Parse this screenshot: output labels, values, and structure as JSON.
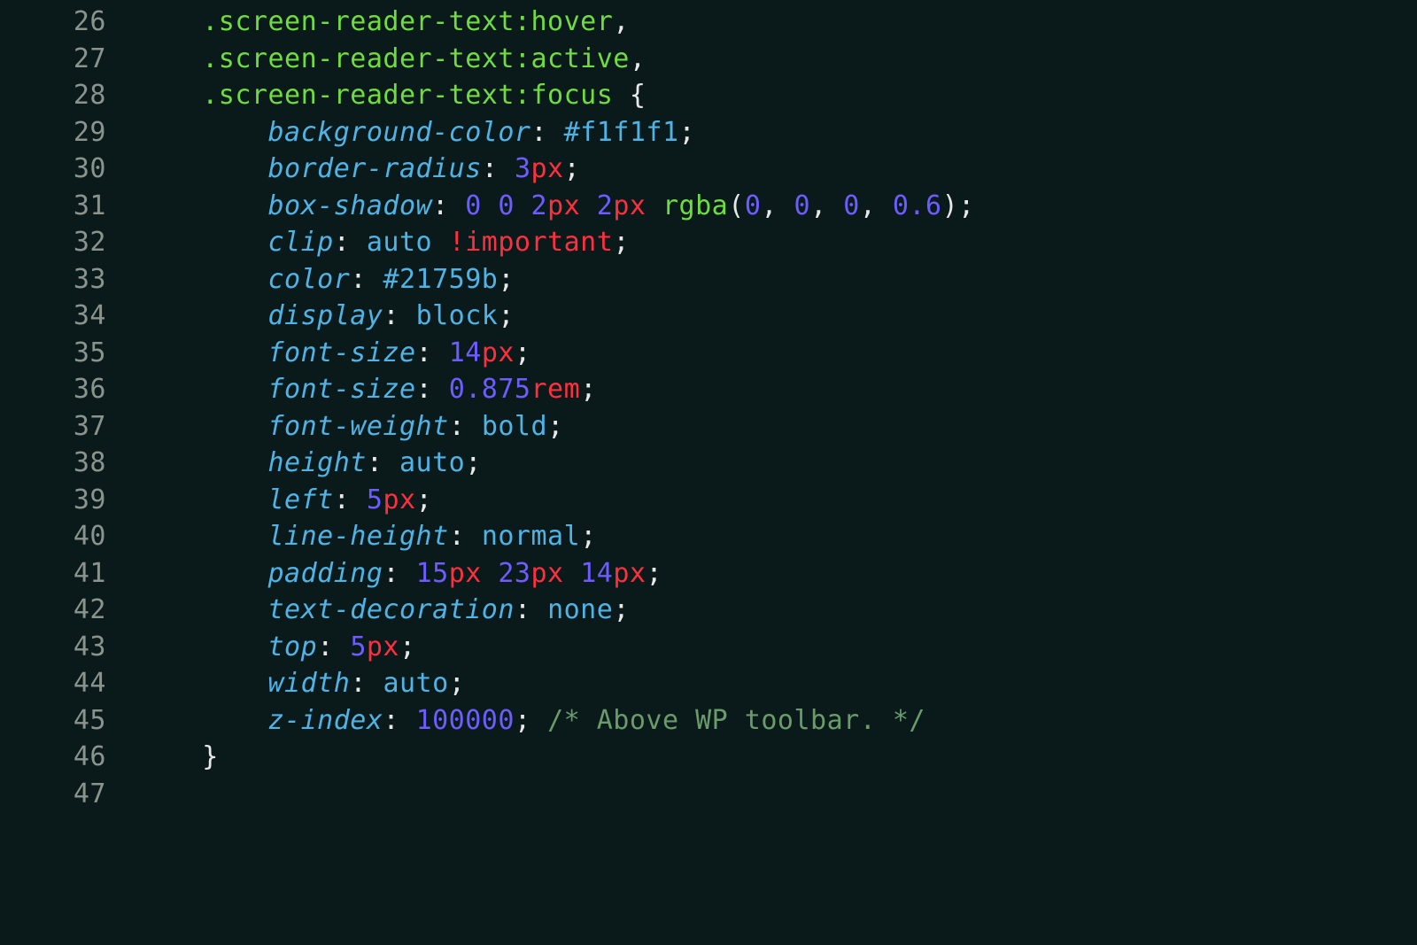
{
  "lines": [
    {
      "num": "26",
      "indent": 1,
      "tokens": [
        {
          "class": "selector",
          "text": ".screen-reader-text"
        },
        {
          "class": "selector",
          "text": ":"
        },
        {
          "class": "pseudo",
          "text": "hover"
        },
        {
          "class": "comma",
          "text": ","
        }
      ]
    },
    {
      "num": "27",
      "indent": 1,
      "tokens": [
        {
          "class": "selector",
          "text": ".screen-reader-text"
        },
        {
          "class": "selector",
          "text": ":"
        },
        {
          "class": "pseudo",
          "text": "active"
        },
        {
          "class": "comma",
          "text": ","
        }
      ]
    },
    {
      "num": "28",
      "indent": 1,
      "tokens": [
        {
          "class": "selector",
          "text": ".screen-reader-text"
        },
        {
          "class": "selector",
          "text": ":"
        },
        {
          "class": "pseudo",
          "text": "focus"
        },
        {
          "class": "brace",
          "text": " {"
        }
      ]
    },
    {
      "num": "29",
      "indent": 2,
      "tokens": [
        {
          "class": "prop",
          "text": "background-color"
        },
        {
          "class": "colon",
          "text": ": "
        },
        {
          "class": "hex",
          "text": "#f1f1f1"
        },
        {
          "class": "semicolon",
          "text": ";"
        }
      ]
    },
    {
      "num": "30",
      "indent": 2,
      "tokens": [
        {
          "class": "prop",
          "text": "border-radius"
        },
        {
          "class": "colon",
          "text": ": "
        },
        {
          "class": "num",
          "text": "3"
        },
        {
          "class": "unit",
          "text": "px"
        },
        {
          "class": "semicolon",
          "text": ";"
        }
      ]
    },
    {
      "num": "31",
      "indent": 2,
      "tokens": [
        {
          "class": "prop",
          "text": "box-shadow"
        },
        {
          "class": "colon",
          "text": ": "
        },
        {
          "class": "num",
          "text": "0"
        },
        {
          "class": "punct",
          "text": " "
        },
        {
          "class": "num",
          "text": "0"
        },
        {
          "class": "punct",
          "text": " "
        },
        {
          "class": "num",
          "text": "2"
        },
        {
          "class": "unit",
          "text": "px"
        },
        {
          "class": "punct",
          "text": " "
        },
        {
          "class": "num",
          "text": "2"
        },
        {
          "class": "unit",
          "text": "px"
        },
        {
          "class": "punct",
          "text": " "
        },
        {
          "class": "func",
          "text": "rgba"
        },
        {
          "class": "paren",
          "text": "("
        },
        {
          "class": "num",
          "text": "0"
        },
        {
          "class": "punct",
          "text": ", "
        },
        {
          "class": "num",
          "text": "0"
        },
        {
          "class": "punct",
          "text": ", "
        },
        {
          "class": "num",
          "text": "0"
        },
        {
          "class": "punct",
          "text": ", "
        },
        {
          "class": "num",
          "text": "0.6"
        },
        {
          "class": "paren",
          "text": ")"
        },
        {
          "class": "semicolon",
          "text": ";"
        }
      ]
    },
    {
      "num": "32",
      "indent": 2,
      "tokens": [
        {
          "class": "prop",
          "text": "clip"
        },
        {
          "class": "colon",
          "text": ": "
        },
        {
          "class": "ident",
          "text": "auto"
        },
        {
          "class": "punct",
          "text": " "
        },
        {
          "class": "important",
          "text": "!important"
        },
        {
          "class": "semicolon",
          "text": ";"
        }
      ]
    },
    {
      "num": "33",
      "indent": 2,
      "tokens": [
        {
          "class": "prop",
          "text": "color"
        },
        {
          "class": "colon",
          "text": ": "
        },
        {
          "class": "hex",
          "text": "#21759b"
        },
        {
          "class": "semicolon",
          "text": ";"
        }
      ]
    },
    {
      "num": "34",
      "indent": 2,
      "tokens": [
        {
          "class": "prop",
          "text": "display"
        },
        {
          "class": "colon",
          "text": ": "
        },
        {
          "class": "ident",
          "text": "block"
        },
        {
          "class": "semicolon",
          "text": ";"
        }
      ]
    },
    {
      "num": "35",
      "indent": 2,
      "tokens": [
        {
          "class": "prop",
          "text": "font-size"
        },
        {
          "class": "colon",
          "text": ": "
        },
        {
          "class": "num",
          "text": "14"
        },
        {
          "class": "unit",
          "text": "px"
        },
        {
          "class": "semicolon",
          "text": ";"
        }
      ]
    },
    {
      "num": "36",
      "indent": 2,
      "tokens": [
        {
          "class": "prop",
          "text": "font-size"
        },
        {
          "class": "colon",
          "text": ": "
        },
        {
          "class": "num",
          "text": "0.875"
        },
        {
          "class": "unit",
          "text": "rem"
        },
        {
          "class": "semicolon",
          "text": ";"
        }
      ]
    },
    {
      "num": "37",
      "indent": 2,
      "tokens": [
        {
          "class": "prop",
          "text": "font-weight"
        },
        {
          "class": "colon",
          "text": ": "
        },
        {
          "class": "ident",
          "text": "bold"
        },
        {
          "class": "semicolon",
          "text": ";"
        }
      ]
    },
    {
      "num": "38",
      "indent": 2,
      "tokens": [
        {
          "class": "prop",
          "text": "height"
        },
        {
          "class": "colon",
          "text": ": "
        },
        {
          "class": "ident",
          "text": "auto"
        },
        {
          "class": "semicolon",
          "text": ";"
        }
      ]
    },
    {
      "num": "39",
      "indent": 2,
      "tokens": [
        {
          "class": "prop",
          "text": "left"
        },
        {
          "class": "colon",
          "text": ": "
        },
        {
          "class": "num",
          "text": "5"
        },
        {
          "class": "unit",
          "text": "px"
        },
        {
          "class": "semicolon",
          "text": ";"
        }
      ]
    },
    {
      "num": "40",
      "indent": 2,
      "tokens": [
        {
          "class": "prop",
          "text": "line-height"
        },
        {
          "class": "colon",
          "text": ": "
        },
        {
          "class": "ident",
          "text": "normal"
        },
        {
          "class": "semicolon",
          "text": ";"
        }
      ]
    },
    {
      "num": "41",
      "indent": 2,
      "tokens": [
        {
          "class": "prop",
          "text": "padding"
        },
        {
          "class": "colon",
          "text": ": "
        },
        {
          "class": "num",
          "text": "15"
        },
        {
          "class": "unit",
          "text": "px"
        },
        {
          "class": "punct",
          "text": " "
        },
        {
          "class": "num",
          "text": "23"
        },
        {
          "class": "unit",
          "text": "px"
        },
        {
          "class": "punct",
          "text": " "
        },
        {
          "class": "num",
          "text": "14"
        },
        {
          "class": "unit",
          "text": "px"
        },
        {
          "class": "semicolon",
          "text": ";"
        }
      ]
    },
    {
      "num": "42",
      "indent": 2,
      "tokens": [
        {
          "class": "prop",
          "text": "text-decoration"
        },
        {
          "class": "colon",
          "text": ": "
        },
        {
          "class": "ident",
          "text": "none"
        },
        {
          "class": "semicolon",
          "text": ";"
        }
      ]
    },
    {
      "num": "43",
      "indent": 2,
      "tokens": [
        {
          "class": "prop",
          "text": "top"
        },
        {
          "class": "colon",
          "text": ": "
        },
        {
          "class": "num",
          "text": "5"
        },
        {
          "class": "unit",
          "text": "px"
        },
        {
          "class": "semicolon",
          "text": ";"
        }
      ]
    },
    {
      "num": "44",
      "indent": 2,
      "tokens": [
        {
          "class": "prop",
          "text": "width"
        },
        {
          "class": "colon",
          "text": ": "
        },
        {
          "class": "ident",
          "text": "auto"
        },
        {
          "class": "semicolon",
          "text": ";"
        }
      ]
    },
    {
      "num": "45",
      "indent": 2,
      "tokens": [
        {
          "class": "prop",
          "text": "z-index"
        },
        {
          "class": "colon",
          "text": ": "
        },
        {
          "class": "num",
          "text": "100000"
        },
        {
          "class": "semicolon",
          "text": ";"
        },
        {
          "class": "punct",
          "text": " "
        },
        {
          "class": "comment",
          "text": "/* Above WP toolbar. */"
        }
      ]
    },
    {
      "num": "46",
      "indent": 1,
      "tokens": [
        {
          "class": "brace",
          "text": "}"
        }
      ]
    },
    {
      "num": "47",
      "indent": 0,
      "tokens": []
    }
  ],
  "indent_unit": "    "
}
